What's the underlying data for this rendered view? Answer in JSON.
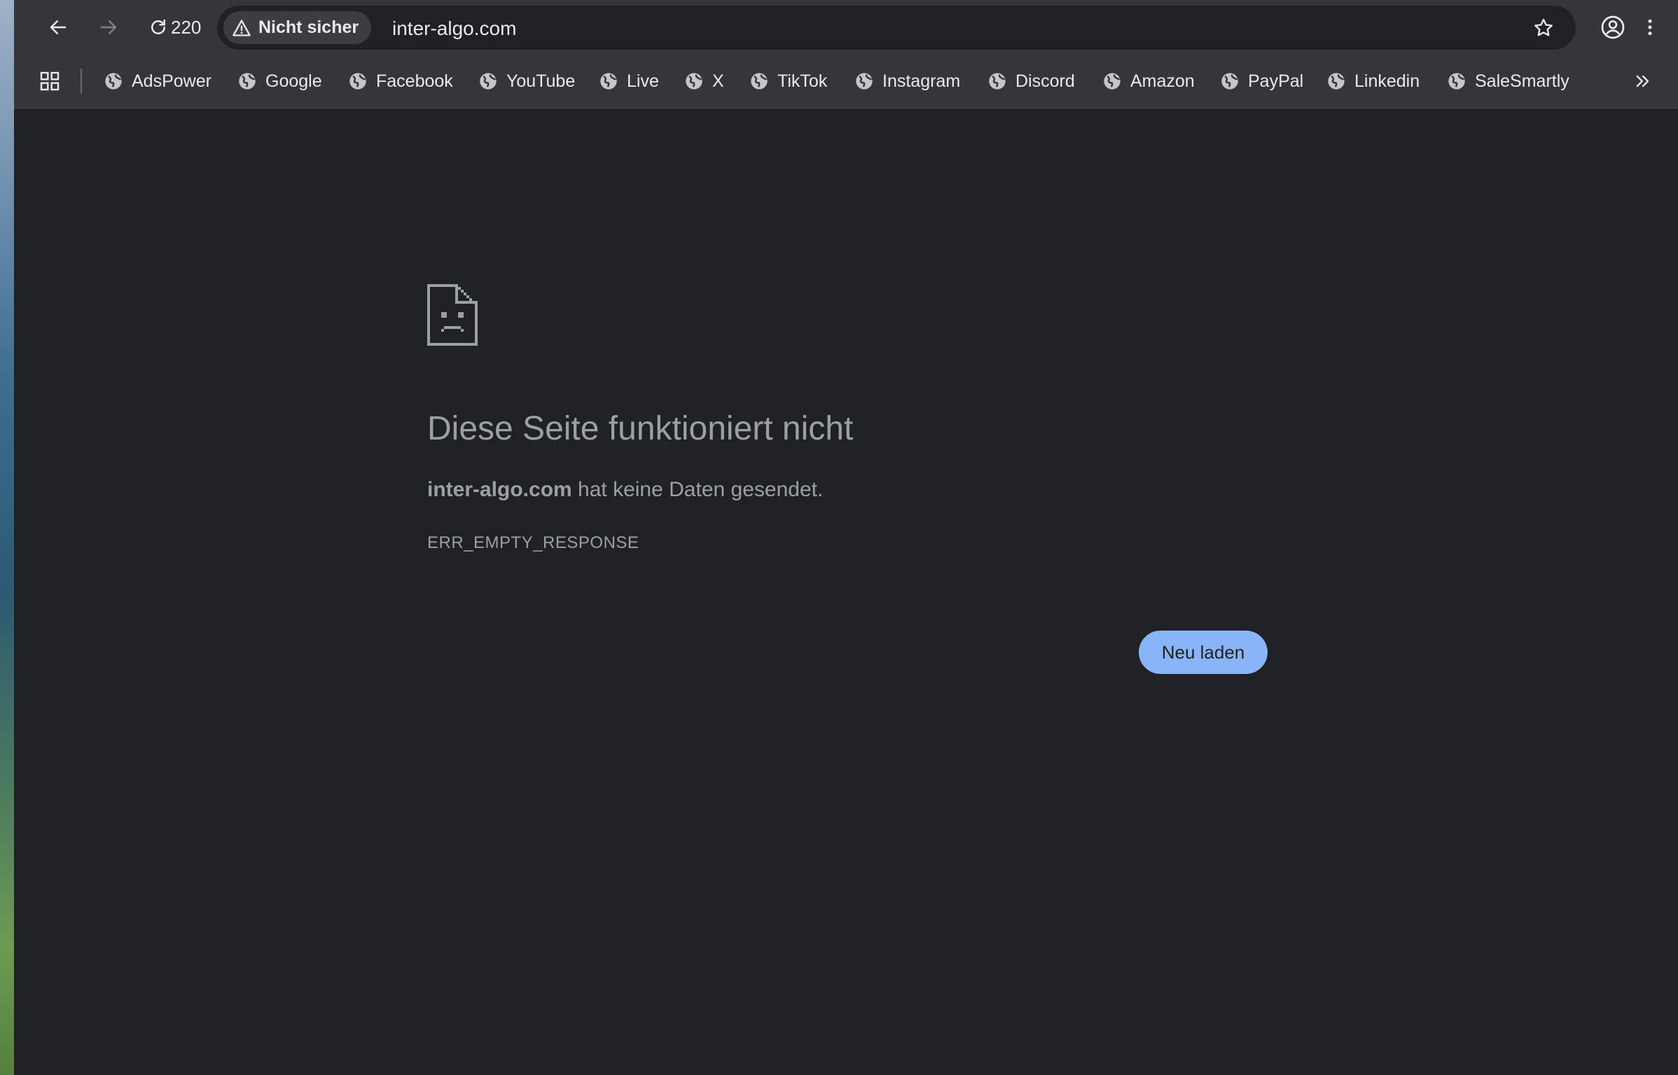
{
  "toolbar": {
    "reload_count": "220",
    "security_chip": "Nicht sicher",
    "url": "inter-algo.com"
  },
  "bookmarks": [
    {
      "label": "AdsPower"
    },
    {
      "label": "Google"
    },
    {
      "label": "Facebook"
    },
    {
      "label": "YouTube"
    },
    {
      "label": "Live"
    },
    {
      "label": "X"
    },
    {
      "label": "TikTok"
    },
    {
      "label": "Instagram"
    },
    {
      "label": "Discord"
    },
    {
      "label": "Amazon"
    },
    {
      "label": "PayPal"
    },
    {
      "label": "Linkedin"
    },
    {
      "label": "SaleSmartly"
    }
  ],
  "error": {
    "title": "Diese Seite funktioniert nicht",
    "host": "inter-algo.com",
    "message": " hat keine Daten gesendet.",
    "code": "ERR_EMPTY_RESPONSE",
    "reload_label": "Neu laden"
  },
  "icons": {
    "back": "arrow-left-icon",
    "forward": "arrow-right-icon",
    "reload": "reload-icon",
    "warning": "warning-icon",
    "star": "star-icon",
    "profile": "profile-icon",
    "menu": "kebab-menu-icon",
    "apps": "apps-grid-icon",
    "bookmark": "globe-icon",
    "overflow": "chevron-double-right-icon",
    "error": "sad-document-icon"
  },
  "colors": {
    "page_bg": "#202124",
    "toolbar_bg": "#35363a",
    "text_muted": "#9aa0a6",
    "button_bg": "#8ab4f8"
  }
}
